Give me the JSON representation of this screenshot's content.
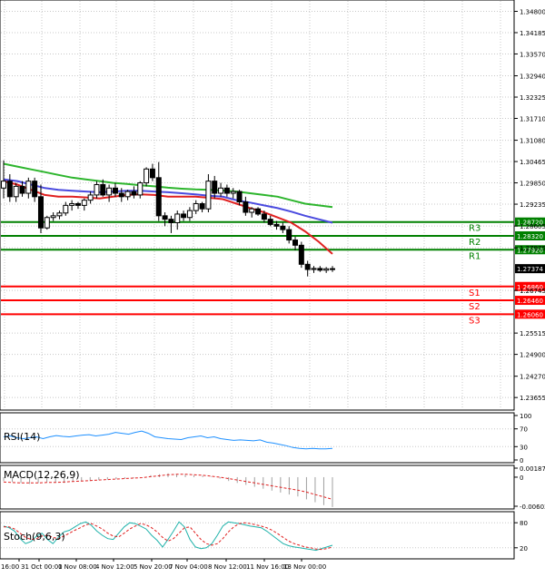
{
  "chart_data": [
    {
      "type": "candlestick",
      "name": "price",
      "y_range": [
        1.2345,
        1.3497
      ],
      "price_axis_ticks": [
        "1.34800",
        "1.34185",
        "1.33570",
        "1.32940",
        "1.32325",
        "1.31710",
        "1.31080",
        "1.30465",
        "1.29850",
        "1.29235",
        "1.28605",
        "1.27975",
        "1.26745",
        "1.25515",
        "1.24900",
        "1.24270",
        "1.23655"
      ],
      "time_axis_ticks": [
        "16:00",
        "31 Oct 00:00",
        "1 Nov 08:00",
        "4 Nov 12:00",
        "5 Nov 20:00",
        "7 Nov 04:00",
        "8 Nov 12:00",
        "11 Nov 16:00",
        "13 Nov 00:00"
      ],
      "current_price": "1.27374",
      "levels": [
        {
          "name": "R3",
          "value": 1.2872,
          "label": "1.28720",
          "color": "#008000"
        },
        {
          "name": "R2",
          "value": 1.2832,
          "label": "1.28320",
          "color": "#008000"
        },
        {
          "name": "R1",
          "value": 1.2792,
          "label": "1.27920",
          "color": "#008000"
        },
        {
          "name": "S1",
          "value": 1.2686,
          "label": "1.26860",
          "color": "#ff0000"
        },
        {
          "name": "S2",
          "value": 1.2646,
          "label": "1.26460",
          "color": "#ff0000"
        },
        {
          "name": "S3",
          "value": 1.2606,
          "label": "1.26060",
          "color": "#ff0000"
        }
      ],
      "candles": [
        {
          "o": 1.297,
          "h": 1.305,
          "l": 1.294,
          "c": 1.299
        },
        {
          "o": 1.299,
          "h": 1.301,
          "l": 1.293,
          "c": 1.2945
        },
        {
          "o": 1.2945,
          "h": 1.2985,
          "l": 1.293,
          "c": 1.2975
        },
        {
          "o": 1.2975,
          "h": 1.299,
          "l": 1.2945,
          "c": 1.2955
        },
        {
          "o": 1.2955,
          "h": 1.3,
          "l": 1.294,
          "c": 1.299
        },
        {
          "o": 1.299,
          "h": 1.3,
          "l": 1.293,
          "c": 1.2945
        },
        {
          "o": 1.2945,
          "h": 1.298,
          "l": 1.284,
          "c": 1.2855
        },
        {
          "o": 1.2855,
          "h": 1.289,
          "l": 1.285,
          "c": 1.2885
        },
        {
          "o": 1.2885,
          "h": 1.29,
          "l": 1.2875,
          "c": 1.289
        },
        {
          "o": 1.289,
          "h": 1.2905,
          "l": 1.288,
          "c": 1.2898
        },
        {
          "o": 1.2898,
          "h": 1.293,
          "l": 1.289,
          "c": 1.292
        },
        {
          "o": 1.292,
          "h": 1.2935,
          "l": 1.2905,
          "c": 1.2925
        },
        {
          "o": 1.2925,
          "h": 1.293,
          "l": 1.291,
          "c": 1.292
        },
        {
          "o": 1.292,
          "h": 1.294,
          "l": 1.2905,
          "c": 1.2935
        },
        {
          "o": 1.2935,
          "h": 1.296,
          "l": 1.2925,
          "c": 1.295
        },
        {
          "o": 1.295,
          "h": 1.299,
          "l": 1.294,
          "c": 1.298
        },
        {
          "o": 1.298,
          "h": 1.2995,
          "l": 1.2945,
          "c": 1.295
        },
        {
          "o": 1.295,
          "h": 1.298,
          "l": 1.293,
          "c": 1.297
        },
        {
          "o": 1.297,
          "h": 1.2985,
          "l": 1.2945,
          "c": 1.2955
        },
        {
          "o": 1.2955,
          "h": 1.297,
          "l": 1.293,
          "c": 1.2945
        },
        {
          "o": 1.2945,
          "h": 1.2965,
          "l": 1.2935,
          "c": 1.296
        },
        {
          "o": 1.296,
          "h": 1.2975,
          "l": 1.294,
          "c": 1.295
        },
        {
          "o": 1.295,
          "h": 1.299,
          "l": 1.294,
          "c": 1.2985
        },
        {
          "o": 1.2985,
          "h": 1.303,
          "l": 1.2975,
          "c": 1.3025
        },
        {
          "o": 1.3025,
          "h": 1.304,
          "l": 1.299,
          "c": 1.3
        },
        {
          "o": 1.3,
          "h": 1.3045,
          "l": 1.2875,
          "c": 1.289
        },
        {
          "o": 1.289,
          "h": 1.29,
          "l": 1.286,
          "c": 1.288
        },
        {
          "o": 1.288,
          "h": 1.289,
          "l": 1.284,
          "c": 1.287
        },
        {
          "o": 1.287,
          "h": 1.2905,
          "l": 1.285,
          "c": 1.2895
        },
        {
          "o": 1.2895,
          "h": 1.2905,
          "l": 1.2875,
          "c": 1.2885
        },
        {
          "o": 1.2885,
          "h": 1.2915,
          "l": 1.2875,
          "c": 1.2905
        },
        {
          "o": 1.2905,
          "h": 1.2935,
          "l": 1.2895,
          "c": 1.2925
        },
        {
          "o": 1.2925,
          "h": 1.293,
          "l": 1.29,
          "c": 1.291
        },
        {
          "o": 1.291,
          "h": 1.301,
          "l": 1.29,
          "c": 1.299
        },
        {
          "o": 1.299,
          "h": 1.3005,
          "l": 1.294,
          "c": 1.2955
        },
        {
          "o": 1.2955,
          "h": 1.2985,
          "l": 1.2945,
          "c": 1.297
        },
        {
          "o": 1.297,
          "h": 1.298,
          "l": 1.2945,
          "c": 1.2955
        },
        {
          "o": 1.2955,
          "h": 1.297,
          "l": 1.294,
          "c": 1.296
        },
        {
          "o": 1.296,
          "h": 1.2965,
          "l": 1.292,
          "c": 1.293
        },
        {
          "o": 1.293,
          "h": 1.2945,
          "l": 1.289,
          "c": 1.29
        },
        {
          "o": 1.29,
          "h": 1.2915,
          "l": 1.2885,
          "c": 1.291
        },
        {
          "o": 1.291,
          "h": 1.2915,
          "l": 1.289,
          "c": 1.2895
        },
        {
          "o": 1.2895,
          "h": 1.2905,
          "l": 1.287,
          "c": 1.288
        },
        {
          "o": 1.288,
          "h": 1.289,
          "l": 1.286,
          "c": 1.2865
        },
        {
          "o": 1.2865,
          "h": 1.2875,
          "l": 1.285,
          "c": 1.286
        },
        {
          "o": 1.286,
          "h": 1.287,
          "l": 1.284,
          "c": 1.285
        },
        {
          "o": 1.285,
          "h": 1.286,
          "l": 1.281,
          "c": 1.282
        },
        {
          "o": 1.282,
          "h": 1.283,
          "l": 1.279,
          "c": 1.2805
        },
        {
          "o": 1.2805,
          "h": 1.2815,
          "l": 1.274,
          "c": 1.275
        },
        {
          "o": 1.275,
          "h": 1.276,
          "l": 1.2715,
          "c": 1.2735
        },
        {
          "o": 1.2735,
          "h": 1.2745,
          "l": 1.2725,
          "c": 1.2738
        },
        {
          "o": 1.2738,
          "h": 1.2745,
          "l": 1.2728,
          "c": 1.2733
        },
        {
          "o": 1.2733,
          "h": 1.2742,
          "l": 1.2725,
          "c": 1.2737
        },
        {
          "o": 1.2737,
          "h": 1.2745,
          "l": 1.2728,
          "c": 1.27374
        }
      ],
      "moving_averages": [
        {
          "color": "#2db52d",
          "values": [
            1.304,
            1.3032,
            1.3024,
            1.3016,
            1.3008,
            1.3,
            1.2995,
            1.299,
            1.2985,
            1.2982,
            1.2978,
            1.2975,
            1.2971,
            1.2968,
            1.2966,
            1.2965,
            1.2963,
            1.296,
            1.2955,
            1.295,
            1.2945,
            1.2935,
            1.2925,
            1.292,
            1.2915
          ]
        },
        {
          "color": "#4a4adf",
          "values": [
            1.2995,
            1.299,
            1.298,
            1.297,
            1.2965,
            1.2962,
            1.296,
            1.2958,
            1.296,
            1.2962,
            1.2962,
            1.296,
            1.2958,
            1.2955,
            1.2952,
            1.2948,
            1.2945,
            1.2935,
            1.2928,
            1.292,
            1.2912,
            1.2902,
            1.289,
            1.288,
            1.287
          ]
        },
        {
          "color": "#e02020",
          "values": [
            1.299,
            1.298,
            1.2965,
            1.295,
            1.2945,
            1.2945,
            1.2943,
            1.294,
            1.2945,
            1.295,
            1.2952,
            1.295,
            1.2945,
            1.2945,
            1.2945,
            1.2942,
            1.2938,
            1.2925,
            1.2912,
            1.29,
            1.2885,
            1.287,
            1.2845,
            1.2815,
            1.278
          ]
        }
      ]
    },
    {
      "type": "line",
      "name": "RSI(14)",
      "label": "RSI(14)",
      "axis_ticks": [
        "100",
        "70",
        "30",
        "0"
      ],
      "range": [
        0,
        100
      ],
      "values": [
        52,
        54,
        50,
        48,
        50,
        52,
        48,
        52,
        55,
        53,
        52,
        54,
        56,
        57,
        54,
        56,
        58,
        62,
        60,
        58,
        62,
        65,
        60,
        52,
        50,
        48,
        47,
        46,
        50,
        52,
        54,
        50,
        52,
        48,
        46,
        44,
        45,
        44,
        43,
        45,
        40,
        38,
        35,
        32,
        28,
        26,
        25,
        26,
        25,
        25,
        26
      ]
    },
    {
      "type": "bar-line",
      "name": "MACD(12,26,9)",
      "label": "MACD(12,26,9)",
      "axis_ticks": [
        "0.001873",
        "0",
        "-0.006032"
      ],
      "range": [
        -0.006032,
        0.001873
      ],
      "histogram": [
        -0.0008,
        -0.001,
        -0.0012,
        -0.0014,
        -0.0012,
        -0.001,
        -0.0011,
        -0.0012,
        -0.0009,
        -0.0008,
        -0.0007,
        -0.0006,
        -0.0005,
        -0.0004,
        -0.0003,
        -0.0002,
        0.0,
        0.0004,
        0.0006,
        0.0008,
        0.0006,
        0.0005,
        0.0004,
        0.0003,
        0.0001,
        -0.0003,
        -0.0008,
        -0.0012,
        -0.0016,
        -0.002,
        -0.0024,
        -0.0028,
        -0.0032,
        -0.0036,
        -0.004,
        -0.0046,
        -0.0052,
        -0.0058,
        -0.0062
      ],
      "signal": [
        -0.001,
        -0.0011,
        -0.0012,
        -0.0012,
        -0.0012,
        -0.0011,
        -0.0011,
        -0.001,
        -0.0009,
        -0.0008,
        -0.0007,
        -0.0006,
        -0.0005,
        -0.0004,
        -0.0003,
        -0.0002,
        -0.0001,
        0.0001,
        0.0003,
        0.0005,
        0.0006,
        0.0006,
        0.0005,
        0.0004,
        0.0002,
        0.0,
        -0.0003,
        -0.0006,
        -0.0009,
        -0.0012,
        -0.0015,
        -0.0018,
        -0.0021,
        -0.0024,
        -0.0027,
        -0.0031,
        -0.0036,
        -0.0041,
        -0.0046
      ]
    },
    {
      "type": "line",
      "name": "Stoch(9,6,3)",
      "label": "Stoch(9,6,3)",
      "axis_ticks": [
        "80",
        "20"
      ],
      "range": [
        0,
        100
      ],
      "k_values": [
        72,
        68,
        60,
        42,
        30,
        35,
        48,
        55,
        40,
        30,
        45,
        58,
        62,
        70,
        78,
        82,
        74,
        60,
        50,
        42,
        40,
        55,
        70,
        80,
        78,
        72,
        65,
        50,
        38,
        22,
        40,
        60,
        82,
        70,
        40,
        22,
        18,
        20,
        30,
        50,
        72,
        82,
        80,
        78,
        75,
        72,
        70,
        68,
        60,
        50,
        40,
        30,
        25,
        22,
        20,
        18,
        16,
        14,
        18,
        22,
        26
      ],
      "d_values": [
        70,
        70,
        65,
        55,
        45,
        40,
        42,
        48,
        50,
        45,
        42,
        48,
        55,
        62,
        68,
        75,
        78,
        72,
        65,
        55,
        48,
        46,
        55,
        65,
        72,
        78,
        75,
        68,
        58,
        45,
        36,
        42,
        55,
        68,
        70,
        55,
        40,
        30,
        26,
        30,
        42,
        58,
        70,
        78,
        80,
        78,
        75,
        72,
        68,
        62,
        54,
        45,
        36,
        30,
        26,
        22,
        20,
        17,
        16,
        18,
        22
      ]
    }
  ]
}
